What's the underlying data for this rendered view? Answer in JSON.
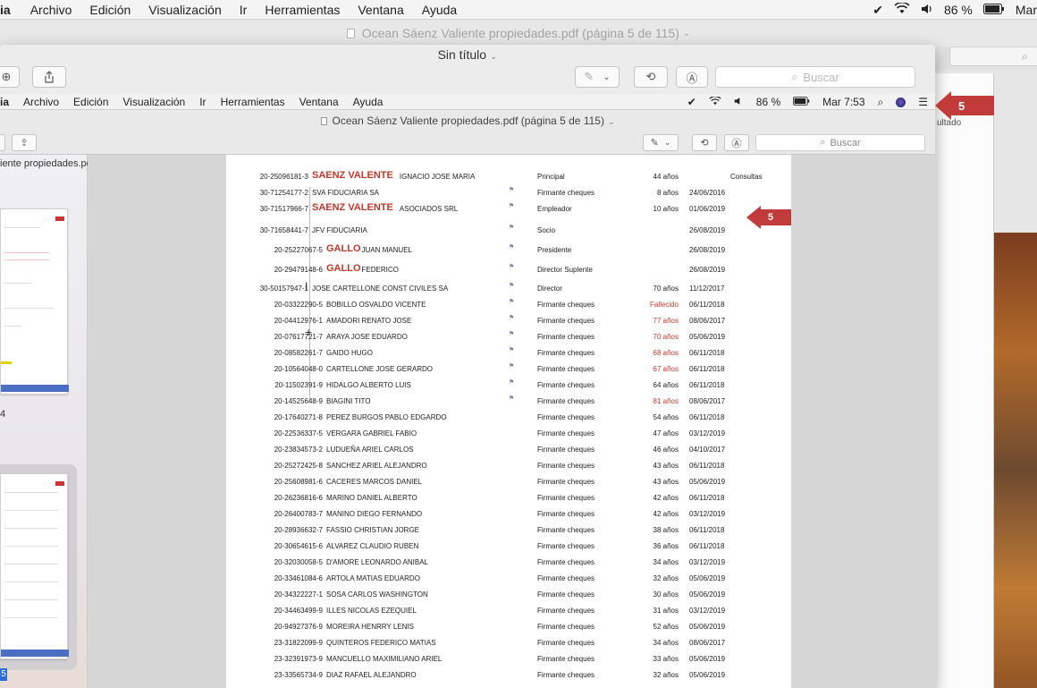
{
  "menubar": {
    "app": "ia",
    "items": [
      "Archivo",
      "Edición",
      "Visualización",
      "Ir",
      "Herramientas",
      "Ventana",
      "Ayuda"
    ],
    "battery": "86 %",
    "clock": "Mar"
  },
  "outer_window": {
    "title": "Ocean Sáenz Valiente propiedades.pdf (página 5 de 115)",
    "side_text": "ultado"
  },
  "front_window": {
    "title": "Sin título",
    "search_placeholder": "Buscar"
  },
  "inner": {
    "menubar": {
      "app": "ia",
      "items": [
        "Archivo",
        "Edición",
        "Visualización",
        "Ir",
        "Herramientas",
        "Ventana",
        "Ayuda"
      ],
      "battery": "86 %",
      "clock": "Mar 7:53"
    },
    "title": "Ocean Sáenz Valiente propiedades.pdf (página 5 de 115)",
    "search_placeholder": "Buscar",
    "sidebar": {
      "filename": "iente propiedades.pdf",
      "page_label_1": "4",
      "page_label_2": "5"
    }
  },
  "arrows": {
    "inner_label": "5",
    "outer_label": "5"
  },
  "document": {
    "header_extra": "Consultas",
    "rows": [
      {
        "cuit": "20-25096181-3",
        "big": "SAENZ VALENTE",
        "name": "IGNACIO JOSE MARIA",
        "flag": "",
        "role": "Principal",
        "age": "44 años",
        "age_red": false,
        "date": ""
      },
      {
        "cuit": "30-71254177-2",
        "big": "",
        "name": "SVA FIDUCIARIA SA",
        "flag": "⚑",
        "role": "Firmante cheques",
        "age": "8 años",
        "age_red": false,
        "date": "24/06/2016"
      },
      {
        "cuit": "30-71517966-7",
        "big": "SAENZ VALENTE",
        "name": "ASOCIADOS SRL",
        "flag": "⚑",
        "role": "Empleador",
        "age": "10 años",
        "age_red": false,
        "date": "01/06/2019"
      },
      {
        "cuit": "30-71658441-7",
        "big": "",
        "name": "JFV FIDUCIARIA",
        "flag": "⚑",
        "role": "Socio",
        "age": "",
        "age_red": false,
        "date": "26/08/2019"
      },
      {
        "cuit": "20-25227067-5",
        "big": "GALLO",
        "name": "JUAN MANUEL",
        "flag": "⚑",
        "role": "Presidente",
        "age": "",
        "age_red": false,
        "date": "26/08/2019"
      },
      {
        "cuit": "20-29479148-6",
        "big": "GALLO",
        "name": "FEDERICO",
        "flag": "⚑",
        "role": "Director Suplente",
        "age": "",
        "age_red": false,
        "date": "26/08/2019"
      },
      {
        "cuit": "30-50157947-1",
        "big": "",
        "name": "JOSE CARTELLONE CONST CIVILES SA",
        "flag": "⚑",
        "role": "Director",
        "age": "70 años",
        "age_red": false,
        "date": "11/12/2017"
      },
      {
        "cuit": "20-03322290-5",
        "big": "",
        "name": "BOBILLO OSVALDO VICENTE",
        "flag": "⚑",
        "role": "Firmante cheques",
        "age": "Fallecido",
        "age_red": true,
        "date": "06/11/2018"
      },
      {
        "cuit": "20-04412976-1",
        "big": "",
        "name": "AMADORI RENATO JOSE",
        "flag": "⚑",
        "role": "Firmante cheques",
        "age": "77 años",
        "age_red": true,
        "date": "08/06/2017"
      },
      {
        "cuit": "20-07617721-7",
        "big": "",
        "name": "ARAYA JOSE EDUARDO",
        "flag": "⚑",
        "role": "Firmante cheques",
        "age": "70 años",
        "age_red": true,
        "date": "05/06/2019"
      },
      {
        "cuit": "20-08582261-7",
        "big": "",
        "name": "GAIDO HUGO",
        "flag": "⚑",
        "role": "Firmante cheques",
        "age": "68 años",
        "age_red": true,
        "date": "06/11/2018"
      },
      {
        "cuit": "20-10564048-0",
        "big": "",
        "name": "CARTELLONE JOSE GERARDO",
        "flag": "⚑",
        "role": "Firmante cheques",
        "age": "67 años",
        "age_red": true,
        "date": "06/11/2018"
      },
      {
        "cuit": "20-11502391-9",
        "big": "",
        "name": "HIDALGO ALBERTO LUIS",
        "flag": "⚑",
        "role": "Firmante cheques",
        "age": "64 años",
        "age_red": false,
        "date": "06/11/2018"
      },
      {
        "cuit": "20-14525648-9",
        "big": "",
        "name": "BIAGINI TITO",
        "flag": "⚑",
        "role": "Firmante cheques",
        "age": "81 años",
        "age_red": true,
        "date": "08/06/2017"
      },
      {
        "cuit": "20-17640271-8",
        "big": "",
        "name": "PEREZ BURGOS PABLO EDGARDO",
        "flag": "",
        "role": "Firmante cheques",
        "age": "54 años",
        "age_red": false,
        "date": "06/11/2018"
      },
      {
        "cuit": "20-22536337-5",
        "big": "",
        "name": "VERGARA GABRIEL FABIO",
        "flag": "",
        "role": "Firmante cheques",
        "age": "47 años",
        "age_red": false,
        "date": "03/12/2019"
      },
      {
        "cuit": "20-23834573-2",
        "big": "",
        "name": "LUDUEÑA ARIEL CARLOS",
        "flag": "",
        "role": "Firmante cheques",
        "age": "46 años",
        "age_red": false,
        "date": "04/10/2017"
      },
      {
        "cuit": "20-25272425-8",
        "big": "",
        "name": "SANCHEZ ARIEL ALEJANDRO",
        "flag": "",
        "role": "Firmante cheques",
        "age": "43 años",
        "age_red": false,
        "date": "06/11/2018"
      },
      {
        "cuit": "20-25608981-6",
        "big": "",
        "name": "CACERES MARCOS DANIEL",
        "flag": "",
        "role": "Firmante cheques",
        "age": "43 años",
        "age_red": false,
        "date": "05/06/2019"
      },
      {
        "cuit": "20-26236816-6",
        "big": "",
        "name": "MARINO DANIEL ALBERTO",
        "flag": "",
        "role": "Firmante cheques",
        "age": "42 años",
        "age_red": false,
        "date": "06/11/2018"
      },
      {
        "cuit": "20-26400783-7",
        "big": "",
        "name": "MANINO DIEGO FERNANDO",
        "flag": "",
        "role": "Firmante cheques",
        "age": "42 años",
        "age_red": false,
        "date": "03/12/2019"
      },
      {
        "cuit": "20-28936632-7",
        "big": "",
        "name": "FASSIO CHRISTIAN JORGE",
        "flag": "",
        "role": "Firmante cheques",
        "age": "38 años",
        "age_red": false,
        "date": "06/11/2018"
      },
      {
        "cuit": "20-30654615-6",
        "big": "",
        "name": "ALVAREZ CLAUDIO RUBEN",
        "flag": "",
        "role": "Firmante cheques",
        "age": "36 años",
        "age_red": false,
        "date": "06/11/2018"
      },
      {
        "cuit": "20-32030058-5",
        "big": "",
        "name": "D'AMORE LEONARDO ANIBAL",
        "flag": "",
        "role": "Firmante cheques",
        "age": "34 años",
        "age_red": false,
        "date": "03/12/2019"
      },
      {
        "cuit": "20-33461084-6",
        "big": "",
        "name": "ARTOLA MATIAS EDUARDO",
        "flag": "",
        "role": "Firmante cheques",
        "age": "32 años",
        "age_red": false,
        "date": "05/06/2019"
      },
      {
        "cuit": "20-34322227-1",
        "big": "",
        "name": "SOSA CARLOS WASHINGTON",
        "flag": "",
        "role": "Firmante cheques",
        "age": "30 años",
        "age_red": false,
        "date": "05/06/2019"
      },
      {
        "cuit": "20-34463499-9",
        "big": "",
        "name": "ILLES NICOLAS EZEQUIEL",
        "flag": "",
        "role": "Firmante cheques",
        "age": "31 años",
        "age_red": false,
        "date": "03/12/2019"
      },
      {
        "cuit": "20-94927376-9",
        "big": "",
        "name": "MOREIRA HENRRY LENIS",
        "flag": "",
        "role": "Firmante cheques",
        "age": "52 años",
        "age_red": false,
        "date": "05/06/2019"
      },
      {
        "cuit": "23-31822099-9",
        "big": "",
        "name": "QUINTEROS FEDERICO MATIAS",
        "flag": "",
        "role": "Firmante cheques",
        "age": "34 años",
        "age_red": false,
        "date": "08/06/2017"
      },
      {
        "cuit": "23-32391973-9",
        "big": "",
        "name": "MANCUELLO MAXIMILIANO ARIEL",
        "flag": "",
        "role": "Firmante cheques",
        "age": "33 años",
        "age_red": false,
        "date": "05/06/2019"
      },
      {
        "cuit": "23-33565734-9",
        "big": "",
        "name": "DIAZ RAFAEL ALEJANDRO",
        "flag": "",
        "role": "Firmante cheques",
        "age": "32 años",
        "age_red": false,
        "date": "05/06/2019"
      }
    ]
  }
}
